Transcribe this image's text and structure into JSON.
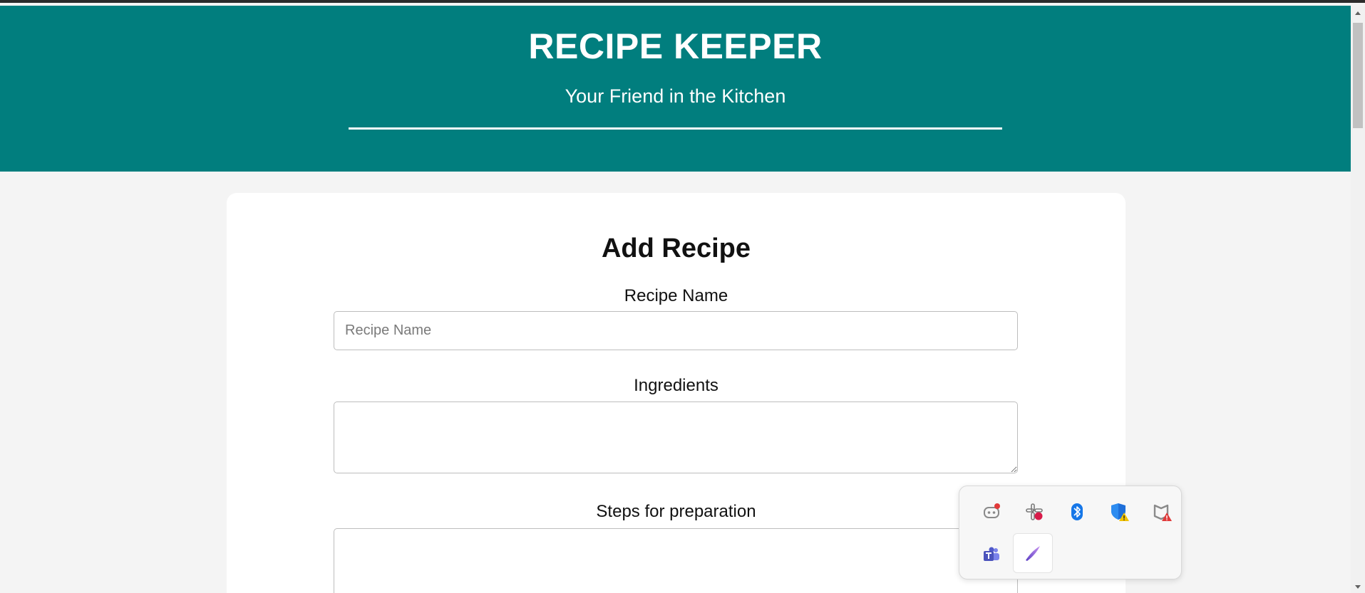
{
  "header": {
    "title": "RECIPE KEEPER",
    "tagline": "Your Friend in the Kitchen"
  },
  "form": {
    "title": "Add Recipe",
    "recipe_name_label": "Recipe Name",
    "recipe_name_placeholder": "Recipe Name",
    "recipe_name_value": "",
    "ingredients_label": "Ingredients",
    "ingredients_value": "",
    "steps_label": "Steps for preparation",
    "steps_value": ""
  },
  "colors": {
    "header_bg": "#017e7e",
    "page_bg": "#f4f4f4",
    "card_bg": "#ffffff"
  },
  "tray": {
    "icons": [
      "discord-icon",
      "slack-icon",
      "bluetooth-icon",
      "windows-security-icon",
      "mcafee-icon",
      "teams-icon",
      "pen-icon"
    ]
  }
}
